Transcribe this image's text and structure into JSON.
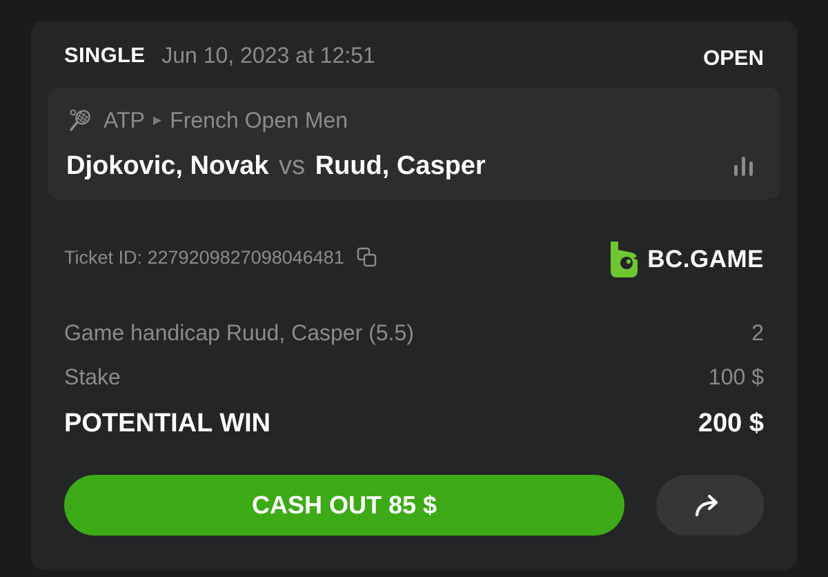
{
  "header": {
    "bet_type": "SINGLE",
    "date": "Jun 10, 2023 at 12:51",
    "status": "OPEN"
  },
  "event": {
    "sport_icon": "tennis-icon",
    "league": "ATP",
    "tournament": "French Open Men",
    "home": "Djokovic, Novak",
    "vs": "vs",
    "away": "Ruud, Casper",
    "stats_icon": "bar-chart-icon"
  },
  "ticket": {
    "label": "Ticket ID: 2279209827098046481",
    "copy_icon": "copy-icon"
  },
  "brand": {
    "name": "BC.GAME",
    "logo_color": "#6fc631"
  },
  "lines": {
    "market_label": "Game handicap Ruud, Casper (5.5)",
    "market_odds": "2",
    "stake_label": "Stake",
    "stake_value": "100 $",
    "win_label": "POTENTIAL WIN",
    "win_value": "200 $"
  },
  "actions": {
    "cashout_label": "CASH OUT 85 $",
    "cashout_color": "#3daa17",
    "share_icon": "share-arrow-icon"
  }
}
